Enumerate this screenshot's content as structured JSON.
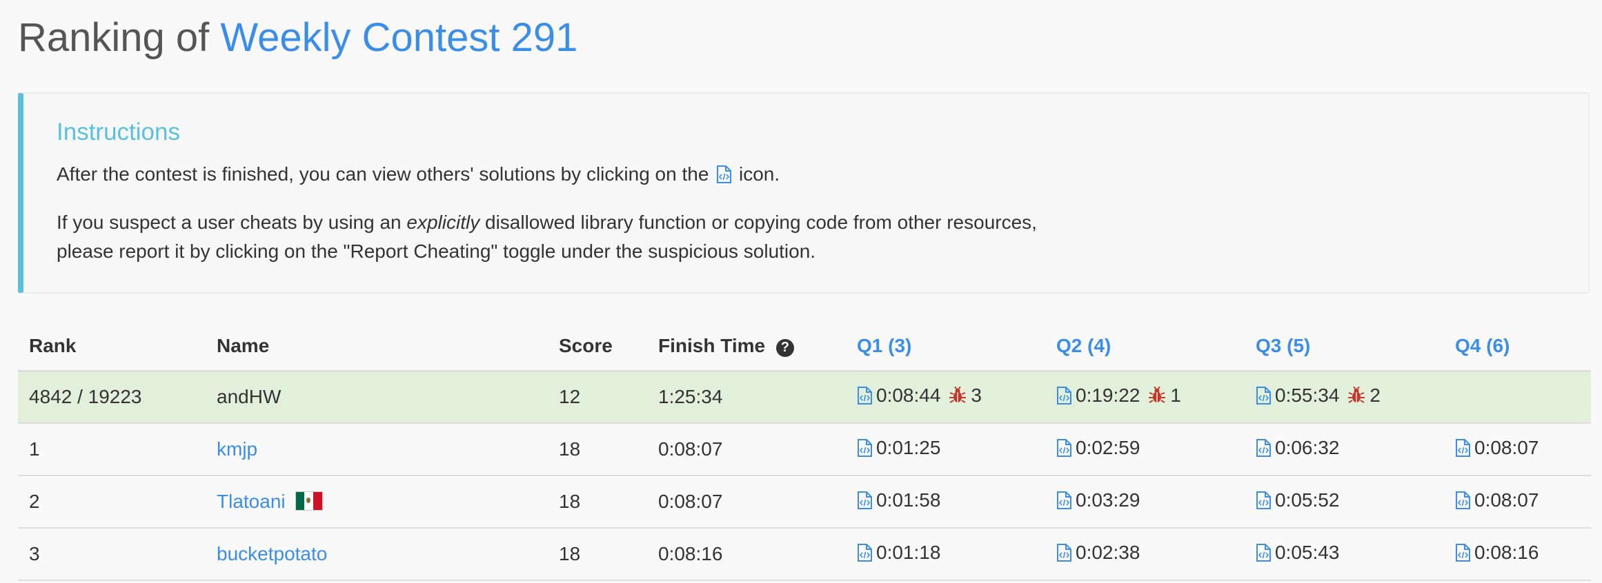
{
  "page": {
    "title_prefix": "Ranking of",
    "contest_name": "Weekly Contest 291"
  },
  "instructions": {
    "heading": "Instructions",
    "line1_before": "After the contest is finished, you can view others' solutions by clicking on the",
    "line1_after": "icon.",
    "line2_before": "If you suspect a user cheats by using an",
    "line2_emphasis": "explicitly",
    "line2_after": "disallowed library function or copying code from other resources,",
    "line3": "please report it by clicking on the \"Report Cheating\" toggle under the suspicious solution."
  },
  "table": {
    "headers": {
      "rank": "Rank",
      "name": "Name",
      "score": "Score",
      "finish_time": "Finish Time",
      "help_icon": "?",
      "q1": "Q1 (3)",
      "q2": "Q2 (4)",
      "q3": "Q3 (5)",
      "q4": "Q4 (6)"
    },
    "rows": [
      {
        "rank": "4842 / 19223",
        "name": "andHW",
        "score": "12",
        "finish": "1:25:34",
        "q1": "0:08:44",
        "q1_bugs": "3",
        "q2": "0:19:22",
        "q2_bugs": "1",
        "q3": "0:55:34",
        "q3_bugs": "2",
        "q4": ""
      },
      {
        "rank": "1",
        "name": "kmjp",
        "score": "18",
        "finish": "0:08:07",
        "q1": "0:01:25",
        "q2": "0:02:59",
        "q3": "0:06:32",
        "q4": "0:08:07"
      },
      {
        "rank": "2",
        "name": "Tlatoani",
        "flag": "mexico-flag-icon",
        "score": "18",
        "finish": "0:08:07",
        "q1": "0:01:58",
        "q2": "0:03:29",
        "q3": "0:05:52",
        "q4": "0:08:07"
      },
      {
        "rank": "3",
        "name": "bucketpotato",
        "score": "18",
        "finish": "0:08:16",
        "q1": "0:01:18",
        "q2": "0:02:38",
        "q3": "0:05:43",
        "q4": "0:08:16"
      }
    ]
  },
  "colors": {
    "accent_blue": "#3b8ee8",
    "info_blue": "#5bc0de",
    "current_user_row": "#e2efda",
    "bug_red": "#c0392b"
  },
  "icons": {
    "solution": "code-file-icon",
    "wrong_submission": "bug-icon",
    "help": "question-circle-icon"
  }
}
